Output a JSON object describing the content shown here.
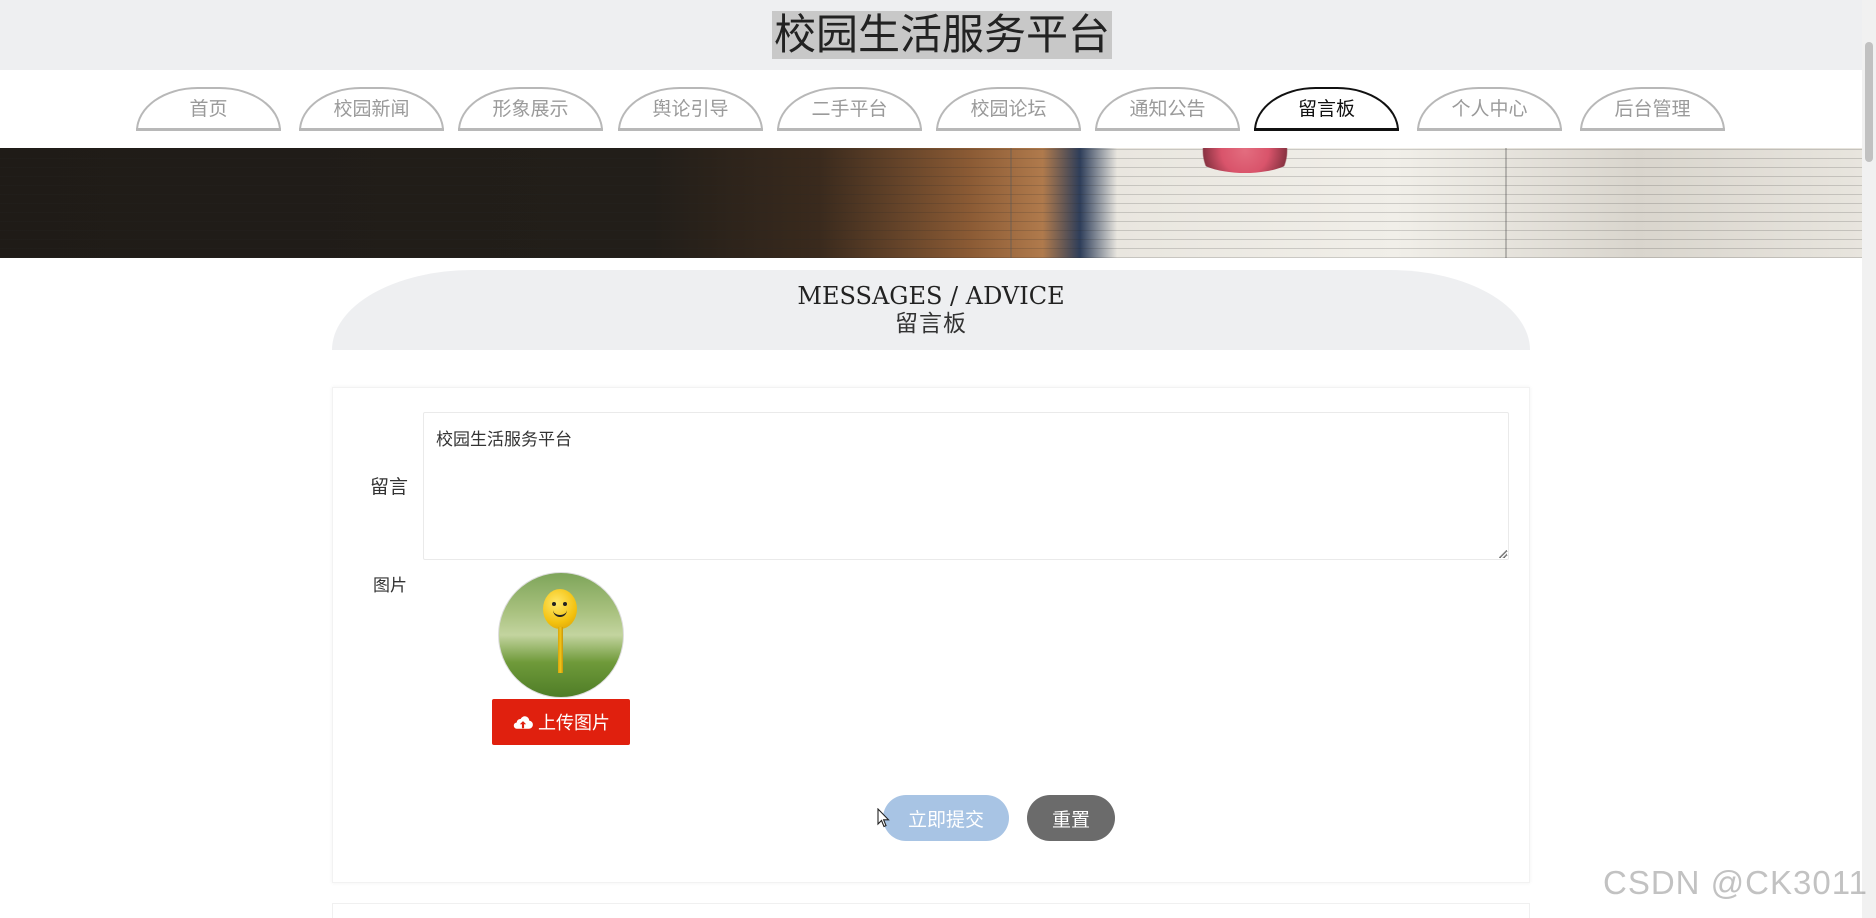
{
  "header": {
    "title": "校园生活服务平台"
  },
  "nav": {
    "items": [
      {
        "label": "首页"
      },
      {
        "label": "校园新闻"
      },
      {
        "label": "形象展示"
      },
      {
        "label": "舆论引导"
      },
      {
        "label": "二手平台"
      },
      {
        "label": "校园论坛"
      },
      {
        "label": "通知公告"
      },
      {
        "label": "留言板",
        "active": true
      },
      {
        "label": "个人中心"
      },
      {
        "label": "后台管理"
      }
    ]
  },
  "section": {
    "title_en": "MESSAGES / ADVICE",
    "title_cn": "留言板"
  },
  "form": {
    "message_label": "留言",
    "message_value": "校园生活服务平台",
    "image_label": "图片",
    "upload_label": "上传图片",
    "submit_label": "立即提交",
    "reset_label": "重置"
  },
  "watermark": "CSDN @CK3011",
  "colors": {
    "upload_button": "#e0200e",
    "submit_button": "#a8c4e4",
    "reset_button": "#6b6b6b",
    "header_bg": "#eeeff1"
  },
  "icons": {
    "upload": "cloud-upload-icon",
    "cursor": "mouse-pointer-icon"
  }
}
